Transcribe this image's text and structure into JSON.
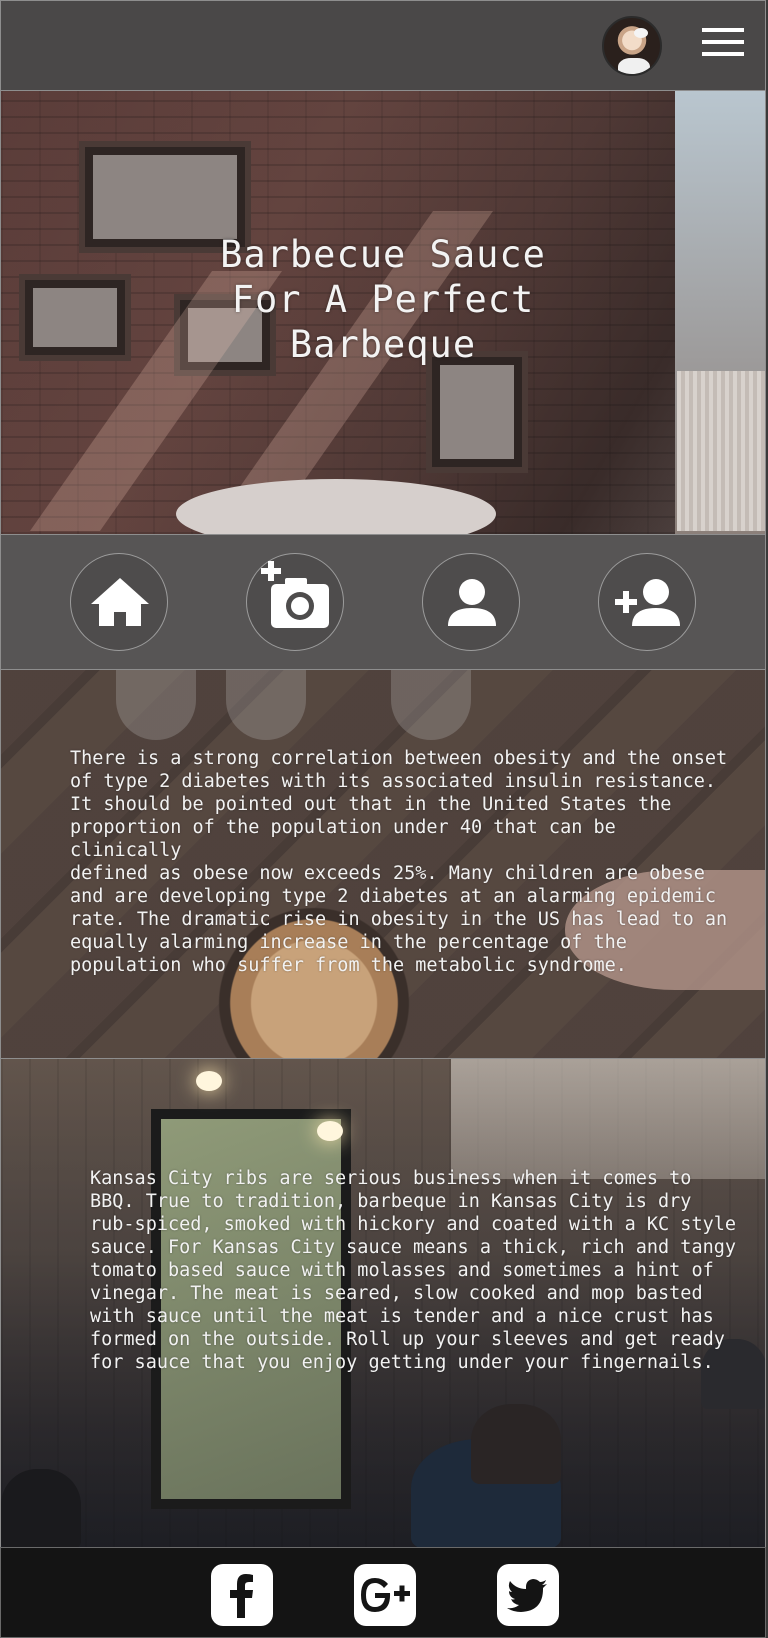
{
  "header": {
    "avatar_alt": "User profile photo",
    "menu_icon": "hamburger-menu-icon"
  },
  "hero": {
    "title": "Barbecue Sauce For A Perfect Barbeque"
  },
  "nav": {
    "items": [
      {
        "name": "home",
        "icon": "home-icon"
      },
      {
        "name": "add-photo",
        "icon": "add-photo-icon"
      },
      {
        "name": "profile",
        "icon": "person-icon"
      },
      {
        "name": "add-friend",
        "icon": "add-person-icon"
      }
    ]
  },
  "content": {
    "section1_text": "There is a strong correlation between obesity and the onset\nof type 2 diabetes with its associated insulin resistance.\nIt should be pointed out that in the United States the\nproportion of the population under 40 that can be clinically\ndefined as obese now exceeds 25%. Many children are obese\nand are developing type 2 diabetes at an alarming epidemic\nrate. The dramatic rise in obesity in the US has lead to an\nequally alarming increase in the percentage of the\npopulation who suffer from the metabolic syndrome.",
    "section2_text": "Kansas City ribs are serious business when it comes to\nBBQ. True to tradition, barbeque in Kansas City is dry\nrub-spiced, smoked with hickory and coated with a KC style\nsauce. For Kansas City sauce means a thick, rich and tangy\ntomato based sauce with molasses and sometimes a hint of\nvinegar. The meat is seared, slow cooked and mop basted\nwith sauce until the meat is tender and a nice crust has\nformed on the outside. Roll up your sleeves and get ready\nfor sauce that you enjoy getting under your fingernails."
  },
  "footer": {
    "social": [
      {
        "name": "facebook",
        "icon": "facebook-icon"
      },
      {
        "name": "google-plus",
        "icon": "google-plus-icon"
      },
      {
        "name": "twitter",
        "icon": "twitter-icon"
      }
    ]
  },
  "colors": {
    "header_bg": "#4a4848",
    "nav_bg": "#575555",
    "footer_bg": "#141414",
    "text": "#ffffff"
  }
}
